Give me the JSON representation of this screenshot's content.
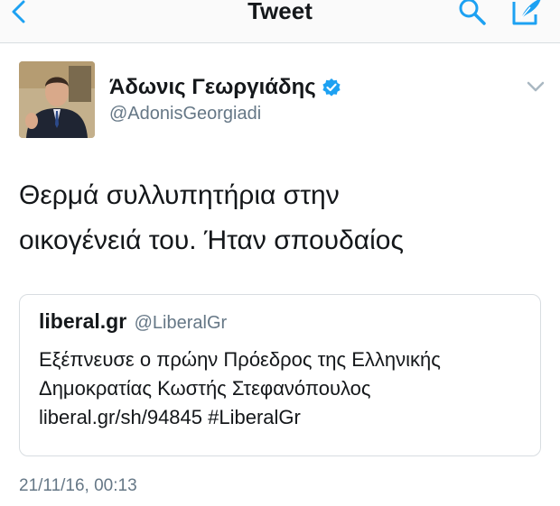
{
  "header": {
    "title": "Tweet",
    "back_icon": "chevron-left-icon",
    "search_icon": "search-icon",
    "compose_icon": "compose-icon"
  },
  "tweet": {
    "author_name": "Άδωνις Γεωργιάδης",
    "author_handle": "@AdonisGeorgiadi",
    "verified": true,
    "text_lines": [
      "Θερμά συλλυπητήρια στην",
      "οικογένειά του. Ήταν σπουδαίος"
    ],
    "timestamp": "21/11/16, 00:13"
  },
  "quoted": {
    "name": "liberal.gr",
    "handle": "@LiberalGr",
    "text_lines": [
      "Εξέπνευσε ο πρώην Πρόεδρος της Ελληνικής",
      "Δημοκρατίας Κωστής Στεφανόπουλος",
      "liberal.gr/sh/94845 #LiberalGr"
    ]
  },
  "colors": {
    "accent": "#1da1f2",
    "text": "#14171a",
    "secondary_text": "#657786",
    "border": "#d8dde1"
  }
}
